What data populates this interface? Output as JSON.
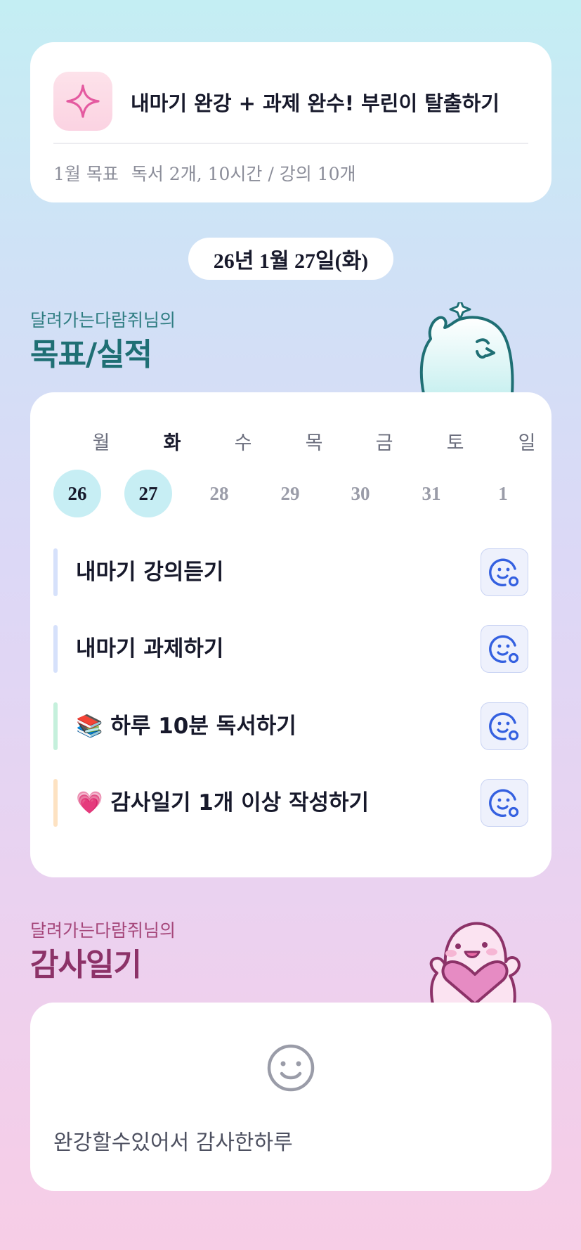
{
  "goal": {
    "title": "내마기 완강 + 과제 완수! 부린이 탈출하기",
    "month_label": "1월 목표",
    "detail": "독서 2개, 10시간 / 강의 10개",
    "icon": "sparkle-icon"
  },
  "date": "26년 1월 27일(화)",
  "goals_section": {
    "owner": "달려가는다람쥐님의",
    "title": "목표/실적"
  },
  "week": {
    "days": [
      {
        "dow": "월",
        "num": "26",
        "done": true
      },
      {
        "dow": "화",
        "num": "27",
        "done": true,
        "today": true
      },
      {
        "dow": "수",
        "num": "28",
        "done": false
      },
      {
        "dow": "목",
        "num": "29",
        "done": false
      },
      {
        "dow": "금",
        "num": "30",
        "done": false
      },
      {
        "dow": "토",
        "num": "31",
        "done": false
      },
      {
        "dow": "일",
        "num": "1",
        "done": false
      }
    ]
  },
  "tasks": [
    {
      "emoji": "",
      "label": "내마기 강의듣기",
      "bar_color": "#d6e1fb",
      "button_icon": "face-check-icon"
    },
    {
      "emoji": "",
      "label": "내마기 과제하기",
      "bar_color": "#d6e1fb",
      "button_icon": "face-check-icon"
    },
    {
      "emoji": "📚",
      "label": "하루 10분 독서하기",
      "bar_color": "#c5f0dc",
      "button_icon": "face-check-icon"
    },
    {
      "emoji": "💗",
      "label": "감사일기 1개 이상 작성하기",
      "bar_color": "#fde2c2",
      "button_icon": "face-check-icon"
    }
  ],
  "thanks_section": {
    "owner": "달려가는다람쥐님의",
    "title": "감사일기",
    "entry": "완강할수있어서 감사한하루",
    "icon": "smiley-icon"
  },
  "colors": {
    "accent_blue": "#3460e0",
    "goals_title": "#1f6f74",
    "thanks_title": "#8c3268",
    "done_day": "#c7eef4"
  }
}
